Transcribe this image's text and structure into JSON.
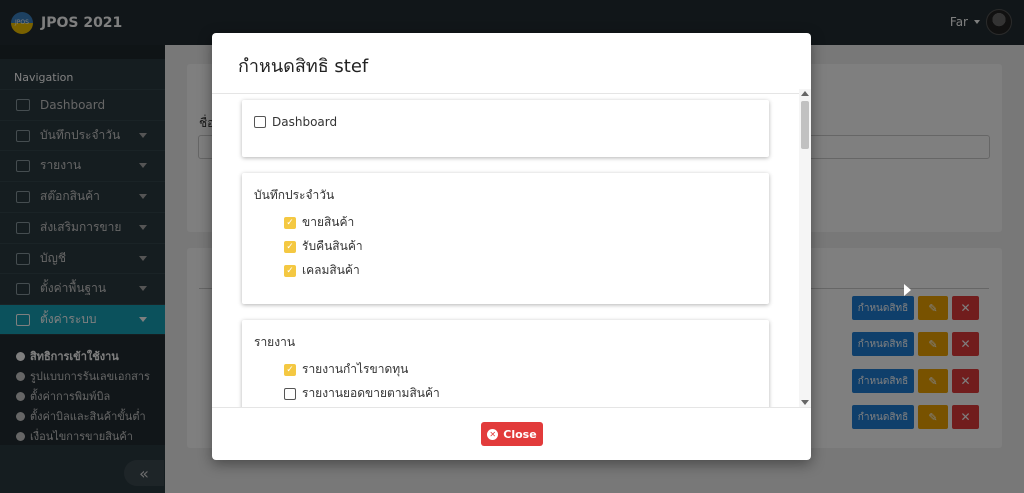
{
  "app": {
    "title": "JPOS 2021",
    "logo_text": "JPOS"
  },
  "user": {
    "name": "Far"
  },
  "sidebar": {
    "header": "Navigation",
    "items": [
      {
        "label": "Dashboard",
        "has_caret": false
      },
      {
        "label": "บันทึกประจำวัน",
        "has_caret": true
      },
      {
        "label": "รายงาน",
        "has_caret": true
      },
      {
        "label": "สต๊อกสินค้า",
        "has_caret": true
      },
      {
        "label": "ส่งเสริมการขาย",
        "has_caret": true
      },
      {
        "label": "บัญชี",
        "has_caret": true
      },
      {
        "label": "ตั้งค่าพื้นฐาน",
        "has_caret": true
      },
      {
        "label": "ตั้งค่าระบบ",
        "has_caret": true,
        "active": true
      }
    ],
    "sub_items": [
      {
        "label": "สิทธิการเข้าใช้งาน",
        "current": true
      },
      {
        "label": "รูปแบบการรันเลขเอกสาร"
      },
      {
        "label": "ตั้งค่าการพิมพ์บิล"
      },
      {
        "label": "ตั้งค่าบิลและสินค้าขั้นต่ำ"
      },
      {
        "label": "เงื่อนไขการขายสินค้า"
      }
    ],
    "collapse_label": "«"
  },
  "background": {
    "label_partial": "ชื่อ",
    "row_buttons": {
      "permission_label": "กำหนดสิทธิ",
      "edit_icon": "pencil-icon",
      "delete_icon": "x-icon"
    }
  },
  "modal": {
    "title": "กำหนดสิทธิ stef",
    "sections": [
      {
        "title": "",
        "items": [
          {
            "label": "Dashboard",
            "checked": false
          }
        ]
      },
      {
        "title": "บันทึกประจำวัน",
        "items": [
          {
            "label": "ขายสินค้า",
            "checked": true
          },
          {
            "label": "รับคืนสินค้า",
            "checked": true
          },
          {
            "label": "เคลมสินค้า",
            "checked": true
          }
        ]
      },
      {
        "title": "รายงาน",
        "items": [
          {
            "label": "รายงานกำไรขาดทุน",
            "checked": true
          },
          {
            "label": "รายงานยอดขายตามสินค้า",
            "checked": false
          }
        ]
      }
    ],
    "close_label": "Close"
  },
  "colors": {
    "accent": "#17a2b8",
    "primary": "#1f7fd6",
    "warning": "#f0a500",
    "danger": "#e23b3b",
    "check": "#f4c842"
  }
}
